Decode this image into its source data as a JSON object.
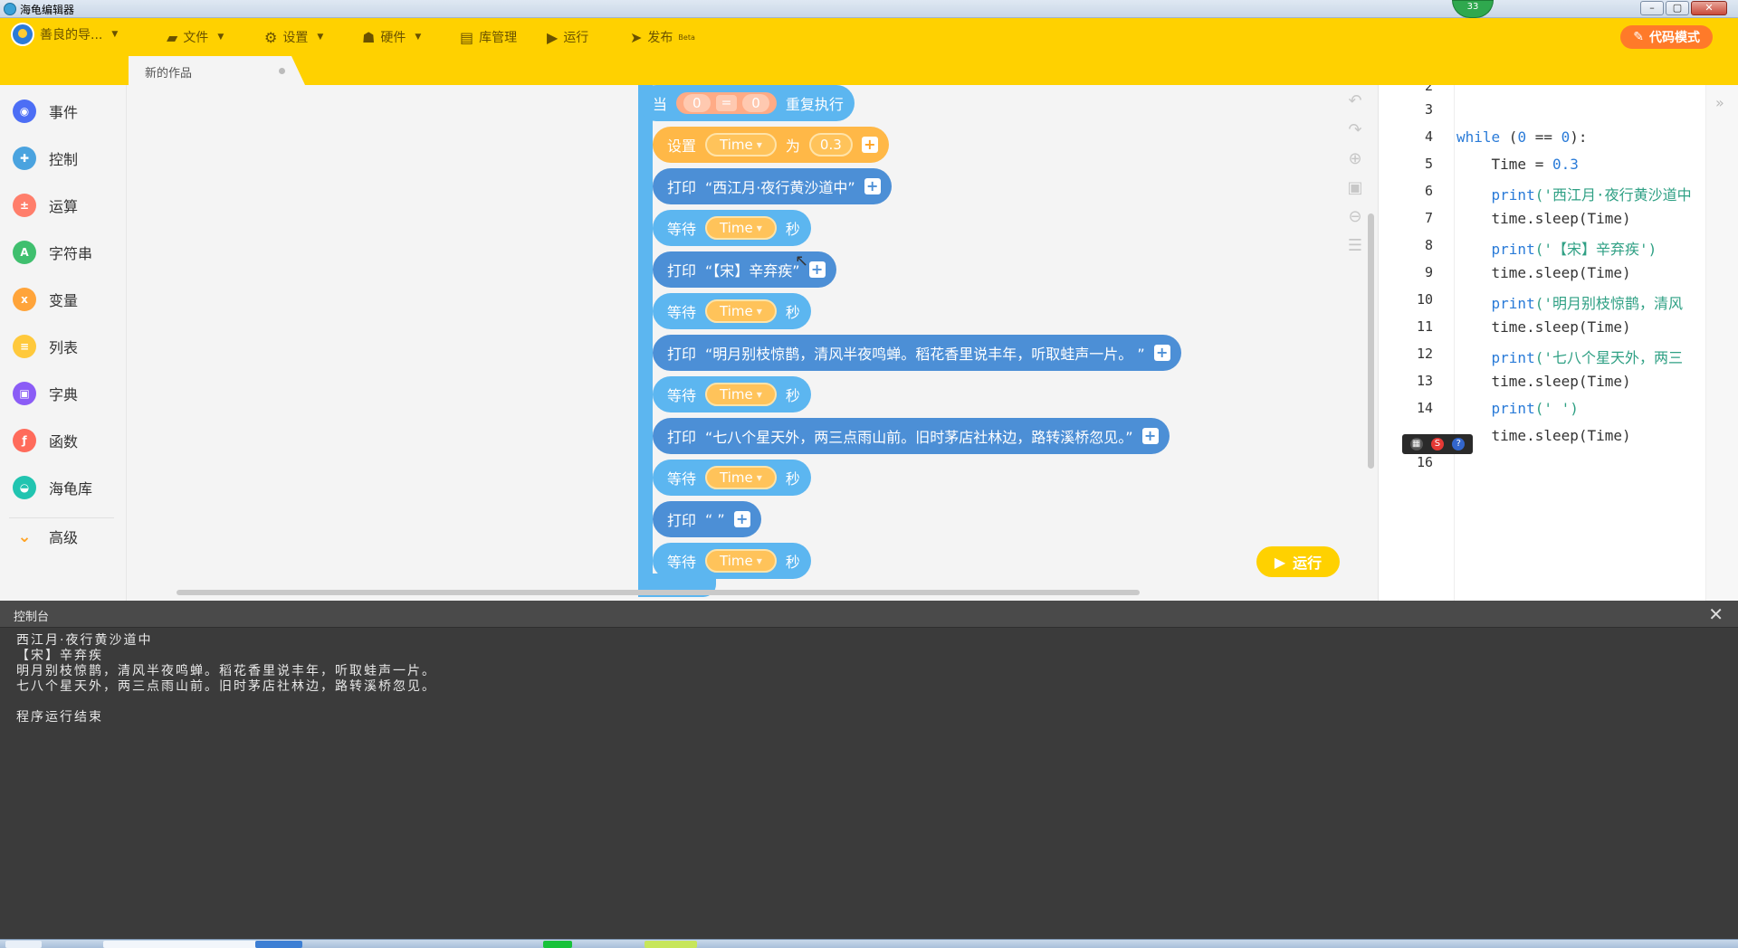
{
  "window": {
    "title": "海龟编辑器",
    "badge": "33",
    "controls": {
      "minimize": "–",
      "maximize": "▢",
      "close": "✕"
    }
  },
  "menubar": {
    "user": "善良的导...",
    "file": "文件",
    "settings": "设置",
    "hardware": "硬件",
    "library": "库管理",
    "run": "运行",
    "publish": "发布",
    "publish_sup": "Beta",
    "code_mode": "代码模式"
  },
  "tab": {
    "label": "新的作品"
  },
  "sidebar": {
    "items": [
      {
        "label": "事件",
        "color": "#4c6ef5"
      },
      {
        "label": "控制",
        "color": "#4aa3df"
      },
      {
        "label": "运算",
        "color": "#ff7e6b"
      },
      {
        "label": "字符串",
        "color": "#3fbf6e"
      },
      {
        "label": "变量",
        "color": "#ffa43a"
      },
      {
        "label": "列表",
        "color": "#ffc93c"
      },
      {
        "label": "字典",
        "color": "#8b5cf6"
      },
      {
        "label": "函数",
        "color": "#ff6b5b"
      },
      {
        "label": "海龟库",
        "color": "#21c4b0"
      }
    ],
    "advanced": "高级"
  },
  "blocks": {
    "hat_when": "当",
    "hat_left": "0",
    "hat_op": "=",
    "hat_right": "0",
    "hat_repeat": "重复执行",
    "set_label": "设置",
    "set_var": "Time",
    "set_as": "为",
    "set_value": "0.3",
    "print_label": "打印",
    "wait_label": "等待",
    "wait_var": "Time",
    "wait_unit": "秒",
    "print1": "“西江月·夜行黄沙道中”",
    "print2": "“【宋】辛弃疾”",
    "print3": "“明月别枝惊鹊，清风半夜鸣蝉。稻花香里说丰年，听取蛙声一片。 ”",
    "print4": "“七八个星天外，两三点雨山前。旧时茅店社林边，路转溪桥忽见。”",
    "print5": "“ ”"
  },
  "run_button": "运行",
  "code": {
    "line_numbers": [
      "2",
      "3",
      "4",
      "5",
      "6",
      "7",
      "8",
      "9",
      "10",
      "11",
      "12",
      "13",
      "14",
      "16"
    ],
    "l4_kw": "while",
    "l4_rest1": " (",
    "l4_n1": "0",
    "l4_op": " == ",
    "l4_n2": "0",
    "l4_rest2": "):",
    "l5_a": "    Time = ",
    "l5_n": "0.3",
    "l6_fn": "    print",
    "l6_s": "('西江月·夜行黄沙道中",
    "sleep": "    time.sleep(Time)",
    "l8_fn": "    print",
    "l8_s": "('【宋】辛弃疾')",
    "l10_fn": "    print",
    "l10_s": "('明月别枝惊鹊，清风",
    "l12_fn": "    print",
    "l12_s": "('七八个星天外，两三",
    "l14_fn": "    print",
    "l14_s": "(' ')"
  },
  "console": {
    "title": "控制台",
    "close": "✕",
    "lines": [
      "西江月·夜行黄沙道中",
      "【宋】辛弃疾",
      "明月别枝惊鹊，清风半夜鸣蝉。稻花香里说丰年，听取蛙声一片。",
      "七八个星天外，两三点雨山前。旧时茅店社林边，路转溪桥忽见。",
      "",
      "程序运行结束"
    ]
  }
}
